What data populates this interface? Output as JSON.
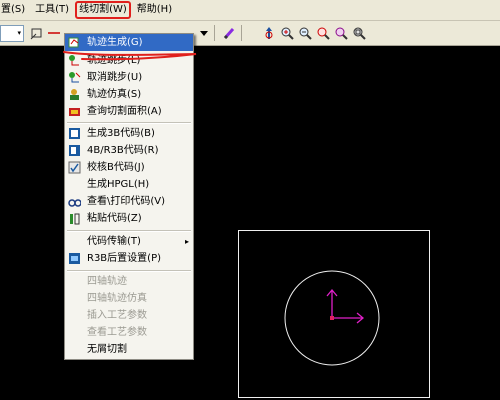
{
  "menubar": {
    "items": [
      {
        "label": "置(S)"
      },
      {
        "label": "工具(T)"
      },
      {
        "label": "线切割(W)"
      },
      {
        "label": "帮助(H)"
      }
    ]
  },
  "toolbar": {
    "combo_arrow": "▾",
    "icons": [
      "rect-select-icon",
      "line-tool-icon",
      "pen-icon",
      "pan-icon",
      "zoom-in-icon",
      "zoom-out-icon",
      "zoom-window-icon",
      "zoom-all-icon",
      "zoom-fit-icon"
    ]
  },
  "wire_cut_menu": {
    "items": [
      {
        "label": "轨迹生成(G)",
        "selected": true,
        "icon": "path-generate-icon"
      },
      {
        "label": "轨迹跳步(L)",
        "icon": "path-jump-icon"
      },
      {
        "label": "取消跳步(U)",
        "icon": "cancel-jump-icon"
      },
      {
        "label": "轨迹仿真(S)",
        "icon": "path-simulate-icon"
      },
      {
        "label": "查询切割面积(A)",
        "icon": "query-area-icon"
      },
      {
        "label": "生成3B代码(B)",
        "icon": "generate-3b-icon"
      },
      {
        "label": "4B/R3B代码(R)",
        "icon": "code-4b-r3b-icon"
      },
      {
        "label": "校核B代码(J)",
        "icon": "check-b-code-icon"
      },
      {
        "label": "生成HPGL(H)"
      },
      {
        "label": "查看\\打印代码(V)",
        "icon": "view-print-icon"
      },
      {
        "label": "粘贴代码(Z)",
        "icon": "paste-code-icon"
      },
      {
        "label": "代码传输(T)",
        "submenu_arrow": "▸"
      },
      {
        "label": "R3B后置设置(P)",
        "icon": "r3b-settings-icon"
      },
      {
        "label": "四轴轨迹",
        "disabled": true
      },
      {
        "label": "四轴轨迹仿真",
        "disabled": true
      },
      {
        "label": "插入工艺参数",
        "disabled": true
      },
      {
        "label": "查看工艺参数",
        "disabled": true
      },
      {
        "label": "无屑切割"
      }
    ]
  },
  "colors": {
    "selection": "#316ac5",
    "annotation_red": "#e0201c",
    "axis_magenta": "#e020c8",
    "canvas_bg": "#000000"
  }
}
